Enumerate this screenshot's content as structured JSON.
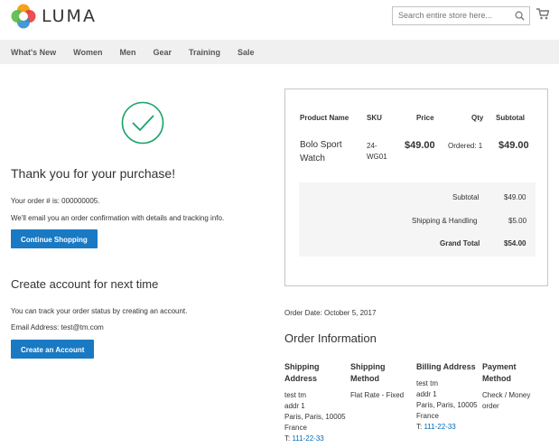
{
  "header": {
    "logo_text": "LUMA",
    "search_placeholder": "Search entire store here..."
  },
  "nav": [
    "What's New",
    "Women",
    "Men",
    "Gear",
    "Training",
    "Sale"
  ],
  "success": {
    "title": "Thank you for your purchase!",
    "order_number_line": "Your order # is: 000000005.",
    "email_line": "We'll email you an order confirmation with details and tracking info.",
    "continue_button": "Continue Shopping"
  },
  "account": {
    "title": "Create account for next time",
    "info_line": "You can track your order status by creating an account.",
    "email_line": "Email Address: test@tm.com",
    "create_button": "Create an Account"
  },
  "summary": {
    "headers": {
      "product": "Product Name",
      "sku": "SKU",
      "price": "Price",
      "qty": "Qty",
      "subtotal": "Subtotal"
    },
    "item": {
      "name_line1": "Bolo Sport",
      "name_line2": "Watch",
      "sku_line1": "24-",
      "sku_line2": "WG01",
      "price": "$49.00",
      "qty": "Ordered: 1",
      "subtotal": "$49.00"
    },
    "totals": {
      "subtotal_label": "Subtotal",
      "subtotal_value": "$49.00",
      "shipping_label": "Shipping & Handling",
      "shipping_value": "$5.00",
      "grand_label": "Grand Total",
      "grand_value": "$54.00"
    }
  },
  "order": {
    "date_line": "Order Date: October 5, 2017",
    "info_title": "Order Information",
    "shipping_address": {
      "title_line1": "Shipping",
      "title_line2": "Address",
      "name": "test tm",
      "street": "addr 1",
      "city": "Paris, Paris, 10005",
      "country": "France",
      "phone_prefix": "T: ",
      "phone": "111-22-33"
    },
    "shipping_method": {
      "title_line1": "Shipping",
      "title_line2": "Method",
      "value": "Flat Rate - Fixed"
    },
    "billing_address": {
      "title": "Billing Address",
      "name": "test tm",
      "street": "addr 1",
      "city": "Paris, Paris, 10005",
      "country": "France",
      "phone_prefix": "T: ",
      "phone": "111-22-33"
    },
    "payment_method": {
      "title_line1": "Payment",
      "title_line2": "Method",
      "value_line1": "Check / Money",
      "value_line2": "order"
    }
  },
  "colors": {
    "accent": "#1979c3",
    "link": "#006bb4",
    "success": "#1aa36a"
  }
}
